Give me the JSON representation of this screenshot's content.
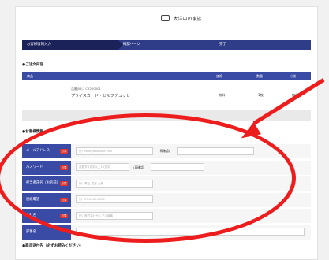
{
  "header": {
    "shop_name": "太洋中の家族"
  },
  "steps": [
    "お客様情報入力",
    "確認ページ",
    "完了"
  ],
  "order": {
    "section_title": "●ご注文内容",
    "columns": [
      "商品",
      "価格",
      "数量",
      "小計"
    ],
    "item": {
      "code": "品番(ID)：C2220001",
      "name": "プライスカード・セルフデュッセ",
      "price": "無料",
      "qty": "1枚",
      "subtotal": "無料"
    }
  },
  "customer": {
    "section_title": "●お客様情報",
    "required": "必須",
    "fields": [
      {
        "label": "メールアドレス",
        "placeholder": "例：taro@example.com",
        "confirm_label": "(再確認)"
      },
      {
        "label": "パスワード",
        "placeholder": "英数字8文字以上16文字",
        "confirm_label": "(再確認)"
      },
      {
        "label": "担当者氏名（お名前）",
        "placeholder": "例：青山 高宮 太郎"
      },
      {
        "label": "連絡電話",
        "placeholder": "例：03-0000-0000"
      },
      {
        "label": "会社名",
        "placeholder": "例：株式会社サンプル商事"
      },
      {
        "label": "部署名"
      }
    ]
  },
  "shipping": {
    "section_title": "●商品送付先（必ずお読みください）"
  },
  "colors": {
    "nav": "#1a2259",
    "header": "#3a4ba6",
    "required": "#d9332f",
    "annotation": "#ee1d1d"
  }
}
